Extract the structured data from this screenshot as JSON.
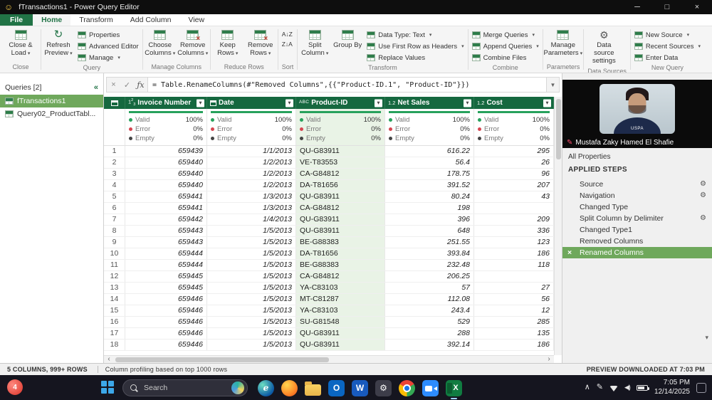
{
  "titlebar": {
    "title": "fTransactions1 - Power Query Editor"
  },
  "ribbon": {
    "tabs": [
      {
        "label": "File"
      },
      {
        "label": "Home"
      },
      {
        "label": "Transform"
      },
      {
        "label": "Add Column"
      },
      {
        "label": "View"
      }
    ],
    "groups": {
      "close": {
        "label": "Close",
        "close_load": "Close & Load"
      },
      "query": {
        "label": "Query",
        "refresh": "Refresh Preview",
        "properties": "Properties",
        "advanced_editor": "Advanced Editor",
        "manage": "Manage"
      },
      "manage_columns": {
        "label": "Manage Columns",
        "choose_columns": "Choose Columns",
        "remove_columns": "Remove Columns"
      },
      "reduce_rows": {
        "label": "Reduce Rows",
        "keep_rows": "Keep Rows",
        "remove_rows": "Remove Rows"
      },
      "sort": {
        "label": "Sort",
        "asc_icon": "A↓Z",
        "desc_icon": "Z↓A"
      },
      "transform": {
        "label": "Transform",
        "split_column": "Split Column",
        "group_by": "Group By",
        "data_type": "Data Type: Text",
        "use_first_row": "Use First Row as Headers",
        "replace_values": "Replace Values"
      },
      "combine": {
        "label": "Combine",
        "merge_queries": "Merge Queries",
        "append_queries": "Append Queries",
        "combine_files": "Combine Files"
      },
      "parameters": {
        "label": "Parameters",
        "manage_parameters": "Manage Parameters"
      },
      "data_sources": {
        "label": "Data Sources",
        "data_source_settings": "Data source settings"
      },
      "new_query": {
        "label": "New Query",
        "new_source": "New Source",
        "recent_sources": "Recent Sources",
        "enter_data": "Enter Data"
      }
    }
  },
  "queries_panel": {
    "header": "Queries [2]",
    "items": [
      {
        "label": "fTransactions1",
        "selected": true
      },
      {
        "label": "Query02_ProductTabl...",
        "selected": false
      }
    ]
  },
  "formula_bar": {
    "formula": "= Table.RenameColumns(#\"Removed Columns\",{{\"Product-ID.1\", \"Product-ID\"}})"
  },
  "table": {
    "columns": [
      {
        "name": "Invoice Number",
        "type": "123",
        "align": "right",
        "selected": false
      },
      {
        "name": "Date",
        "type": "calendar",
        "align": "right",
        "selected": false
      },
      {
        "name": "Product-ID",
        "type": "ABC",
        "align": "left",
        "selected": true
      },
      {
        "name": "Net Sales",
        "type": "12",
        "align": "right",
        "selected": false
      },
      {
        "name": "Cost",
        "type": "12",
        "align": "right",
        "selected": false
      }
    ],
    "quality": {
      "valid_label": "Valid",
      "error_label": "Error",
      "empty_label": "Empty",
      "valid": "100%",
      "error": "0%",
      "empty": "0%"
    },
    "rows": [
      [
        "659439",
        "1/1/2013",
        "QU-G83911",
        "616.22",
        "295"
      ],
      [
        "659440",
        "1/2/2013",
        "VE-T83553",
        "56.4",
        "26"
      ],
      [
        "659440",
        "1/2/2013",
        "CA-G84812",
        "178.75",
        "96"
      ],
      [
        "659440",
        "1/2/2013",
        "DA-T81656",
        "391.52",
        "207"
      ],
      [
        "659441",
        "1/3/2013",
        "QU-G83911",
        "80.24",
        "43"
      ],
      [
        "659441",
        "1/3/2013",
        "CA-G84812",
        "198",
        ""
      ],
      [
        "659442",
        "1/4/2013",
        "QU-G83911",
        "396",
        "209"
      ],
      [
        "659443",
        "1/5/2013",
        "QU-G83911",
        "648",
        "336"
      ],
      [
        "659443",
        "1/5/2013",
        "BE-G88383",
        "251.55",
        "123"
      ],
      [
        "659444",
        "1/5/2013",
        "DA-T81656",
        "393.84",
        "186"
      ],
      [
        "659444",
        "1/5/2013",
        "BE-G88383",
        "232.48",
        "118"
      ],
      [
        "659445",
        "1/5/2013",
        "CA-G84812",
        "206.25",
        ""
      ],
      [
        "659445",
        "1/5/2013",
        "YA-C83103",
        "57",
        "27"
      ],
      [
        "659446",
        "1/5/2013",
        "MT-C81287",
        "112.08",
        "56"
      ],
      [
        "659446",
        "1/5/2013",
        "YA-C83103",
        "243.4",
        "12"
      ],
      [
        "659446",
        "1/5/2013",
        "SU-G81548",
        "529",
        "285"
      ],
      [
        "659446",
        "1/5/2013",
        "QU-G83911",
        "288",
        "135"
      ],
      [
        "659446",
        "1/5/2013",
        "QU-G83911",
        "392.14",
        "186"
      ]
    ]
  },
  "right_panel": {
    "webcam_name": "Mustafa Zaky Hamed El Shafie",
    "shirt_text": "USPA",
    "all_properties": "All Properties",
    "applied_steps_title": "APPLIED STEPS",
    "steps": [
      {
        "label": "Source",
        "gear": true,
        "selected": false
      },
      {
        "label": "Navigation",
        "gear": true,
        "selected": false
      },
      {
        "label": "Changed Type",
        "gear": false,
        "selected": false
      },
      {
        "label": "Split Column by Delimiter",
        "gear": true,
        "selected": false
      },
      {
        "label": "Changed Type1",
        "gear": false,
        "selected": false
      },
      {
        "label": "Removed Columns",
        "gear": false,
        "selected": false
      },
      {
        "label": "Renamed Columns",
        "gear": false,
        "selected": true
      }
    ]
  },
  "status_bar": {
    "columns_rows": "5 COLUMNS, 999+ ROWS",
    "profiling": "Column profiling based on top 1000 rows",
    "preview": "PREVIEW DOWNLOADED AT 7:03 PM"
  },
  "taskbar": {
    "badge": "4",
    "search_placeholder": "Search",
    "apps": [
      {
        "name": "edge",
        "style": "edge",
        "glyph": "e",
        "open": false
      },
      {
        "name": "firefox",
        "style": "firefox",
        "glyph": "",
        "open": false
      },
      {
        "name": "file-explorer",
        "style": "folder",
        "glyph": "",
        "open": false
      },
      {
        "name": "outlook",
        "style": "outlook",
        "glyph": "O",
        "open": false
      },
      {
        "name": "word",
        "style": "word",
        "glyph": "W",
        "open": false
      },
      {
        "name": "settings",
        "style": "settings",
        "glyph": "⚙",
        "open": false
      },
      {
        "name": "chrome",
        "style": "chrome",
        "glyph": "",
        "open": false
      },
      {
        "name": "zoom",
        "style": "zoom",
        "glyph": "",
        "open": false
      },
      {
        "name": "excel",
        "style": "excel",
        "glyph": "X",
        "open": true
      }
    ],
    "time": "7:05 PM",
    "date": "12/14/2025"
  },
  "colors": {
    "brand_green": "#217346",
    "header_green": "#15683f",
    "selection_green": "#6fa85c",
    "column_highlight": "#e9f3e6",
    "valid_green": "#27a15c",
    "error_red": "#d64550"
  }
}
